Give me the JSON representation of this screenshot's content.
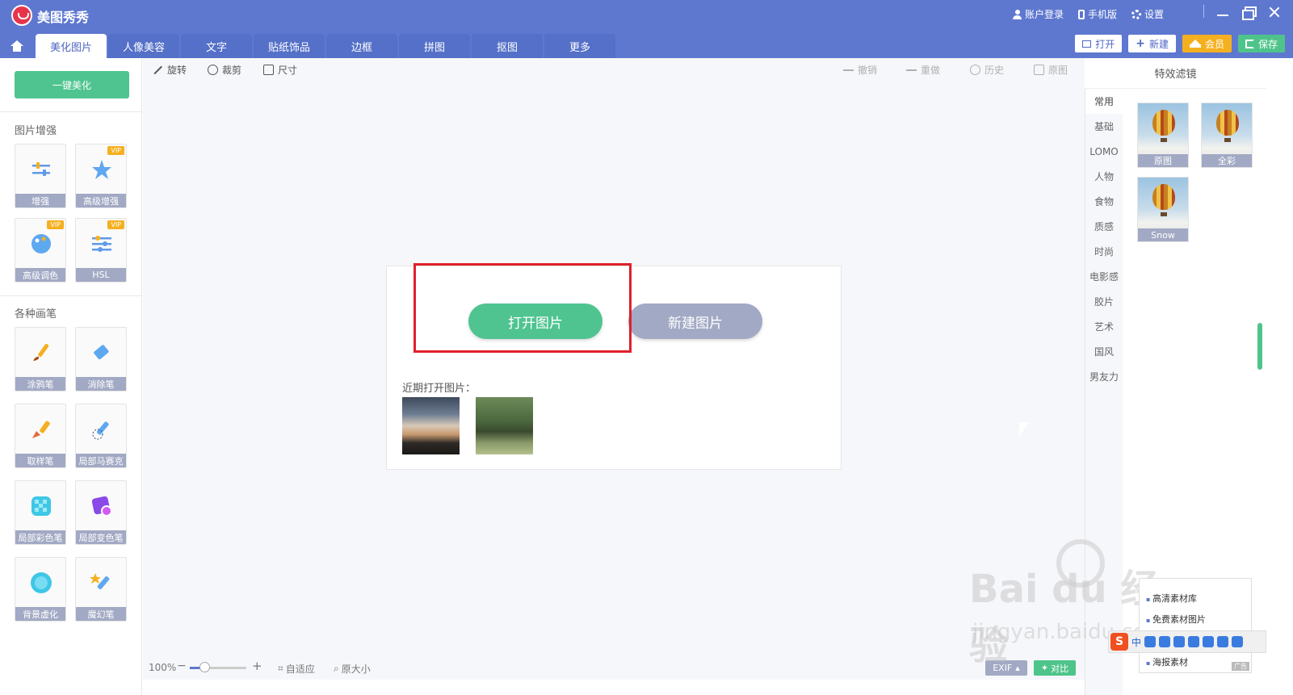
{
  "app": {
    "title": "美图秀秀"
  },
  "top_links": {
    "login": "账户登录",
    "mobile": "手机版",
    "settings": "设置"
  },
  "tabs": [
    {
      "label": "美化图片",
      "active": true
    },
    {
      "label": "人像美容"
    },
    {
      "label": "文字"
    },
    {
      "label": "贴纸饰品"
    },
    {
      "label": "边框"
    },
    {
      "label": "拼图"
    },
    {
      "label": "抠图"
    },
    {
      "label": "更多"
    }
  ],
  "top_actions": {
    "open": "打开",
    "new": "新建",
    "vip": "会员",
    "save": "保存"
  },
  "toolbar": {
    "rotate": "旋转",
    "crop": "裁剪",
    "size": "尺寸",
    "undo": "撤销",
    "redo": "重做",
    "history": "历史",
    "original": "原图"
  },
  "left": {
    "one_key": "一键美化",
    "enhance_title": "图片增强",
    "enhance_tools": [
      {
        "label": "增强"
      },
      {
        "label": "高级增强",
        "badge": "VIP"
      },
      {
        "label": "高级调色",
        "badge": "VIP"
      },
      {
        "label": "HSL",
        "badge": "VIP"
      }
    ],
    "brush_title": "各种画笔",
    "brush_tools": [
      {
        "label": "涂鸦笔"
      },
      {
        "label": "消除笔"
      },
      {
        "label": "取样笔"
      },
      {
        "label": "局部马赛克"
      },
      {
        "label": "局部彩色笔"
      },
      {
        "label": "局部变色笔"
      },
      {
        "label": "背景虚化"
      },
      {
        "label": "魔幻笔"
      }
    ]
  },
  "main": {
    "open_image": "打开图片",
    "new_image": "新建图片",
    "recent_label": "近期打开图片："
  },
  "bottom": {
    "zoom": "100%",
    "zoom_level": 0.25,
    "minus": "−",
    "plus": "+",
    "fit": "自适应",
    "actual": "原大小",
    "exif": "EXIF",
    "compare": "对比"
  },
  "filters": {
    "title": "特效滤镜",
    "categories": [
      "常用",
      "基础",
      "LOMO",
      "人物",
      "食物",
      "质感",
      "时尚",
      "电影感",
      "胶片",
      "艺术",
      "国风",
      "男友力"
    ],
    "items": [
      {
        "label": "原图"
      },
      {
        "label": "全彩"
      },
      {
        "label": "Snow"
      }
    ]
  },
  "ad": {
    "items": [
      "高清素材库",
      "免费素材图片",
      "海报素材"
    ],
    "tag": "广告"
  },
  "ime": {
    "logo": "S",
    "lang": "中"
  },
  "watermark": {
    "logo": "Bai du 经验",
    "sub": "jingyan.baidu.com"
  },
  "colors": {
    "titlebar": "#5e78d0",
    "accent_green": "#4fc490",
    "vip_gold": "#f5b020",
    "highlight_red": "#e0202a"
  }
}
